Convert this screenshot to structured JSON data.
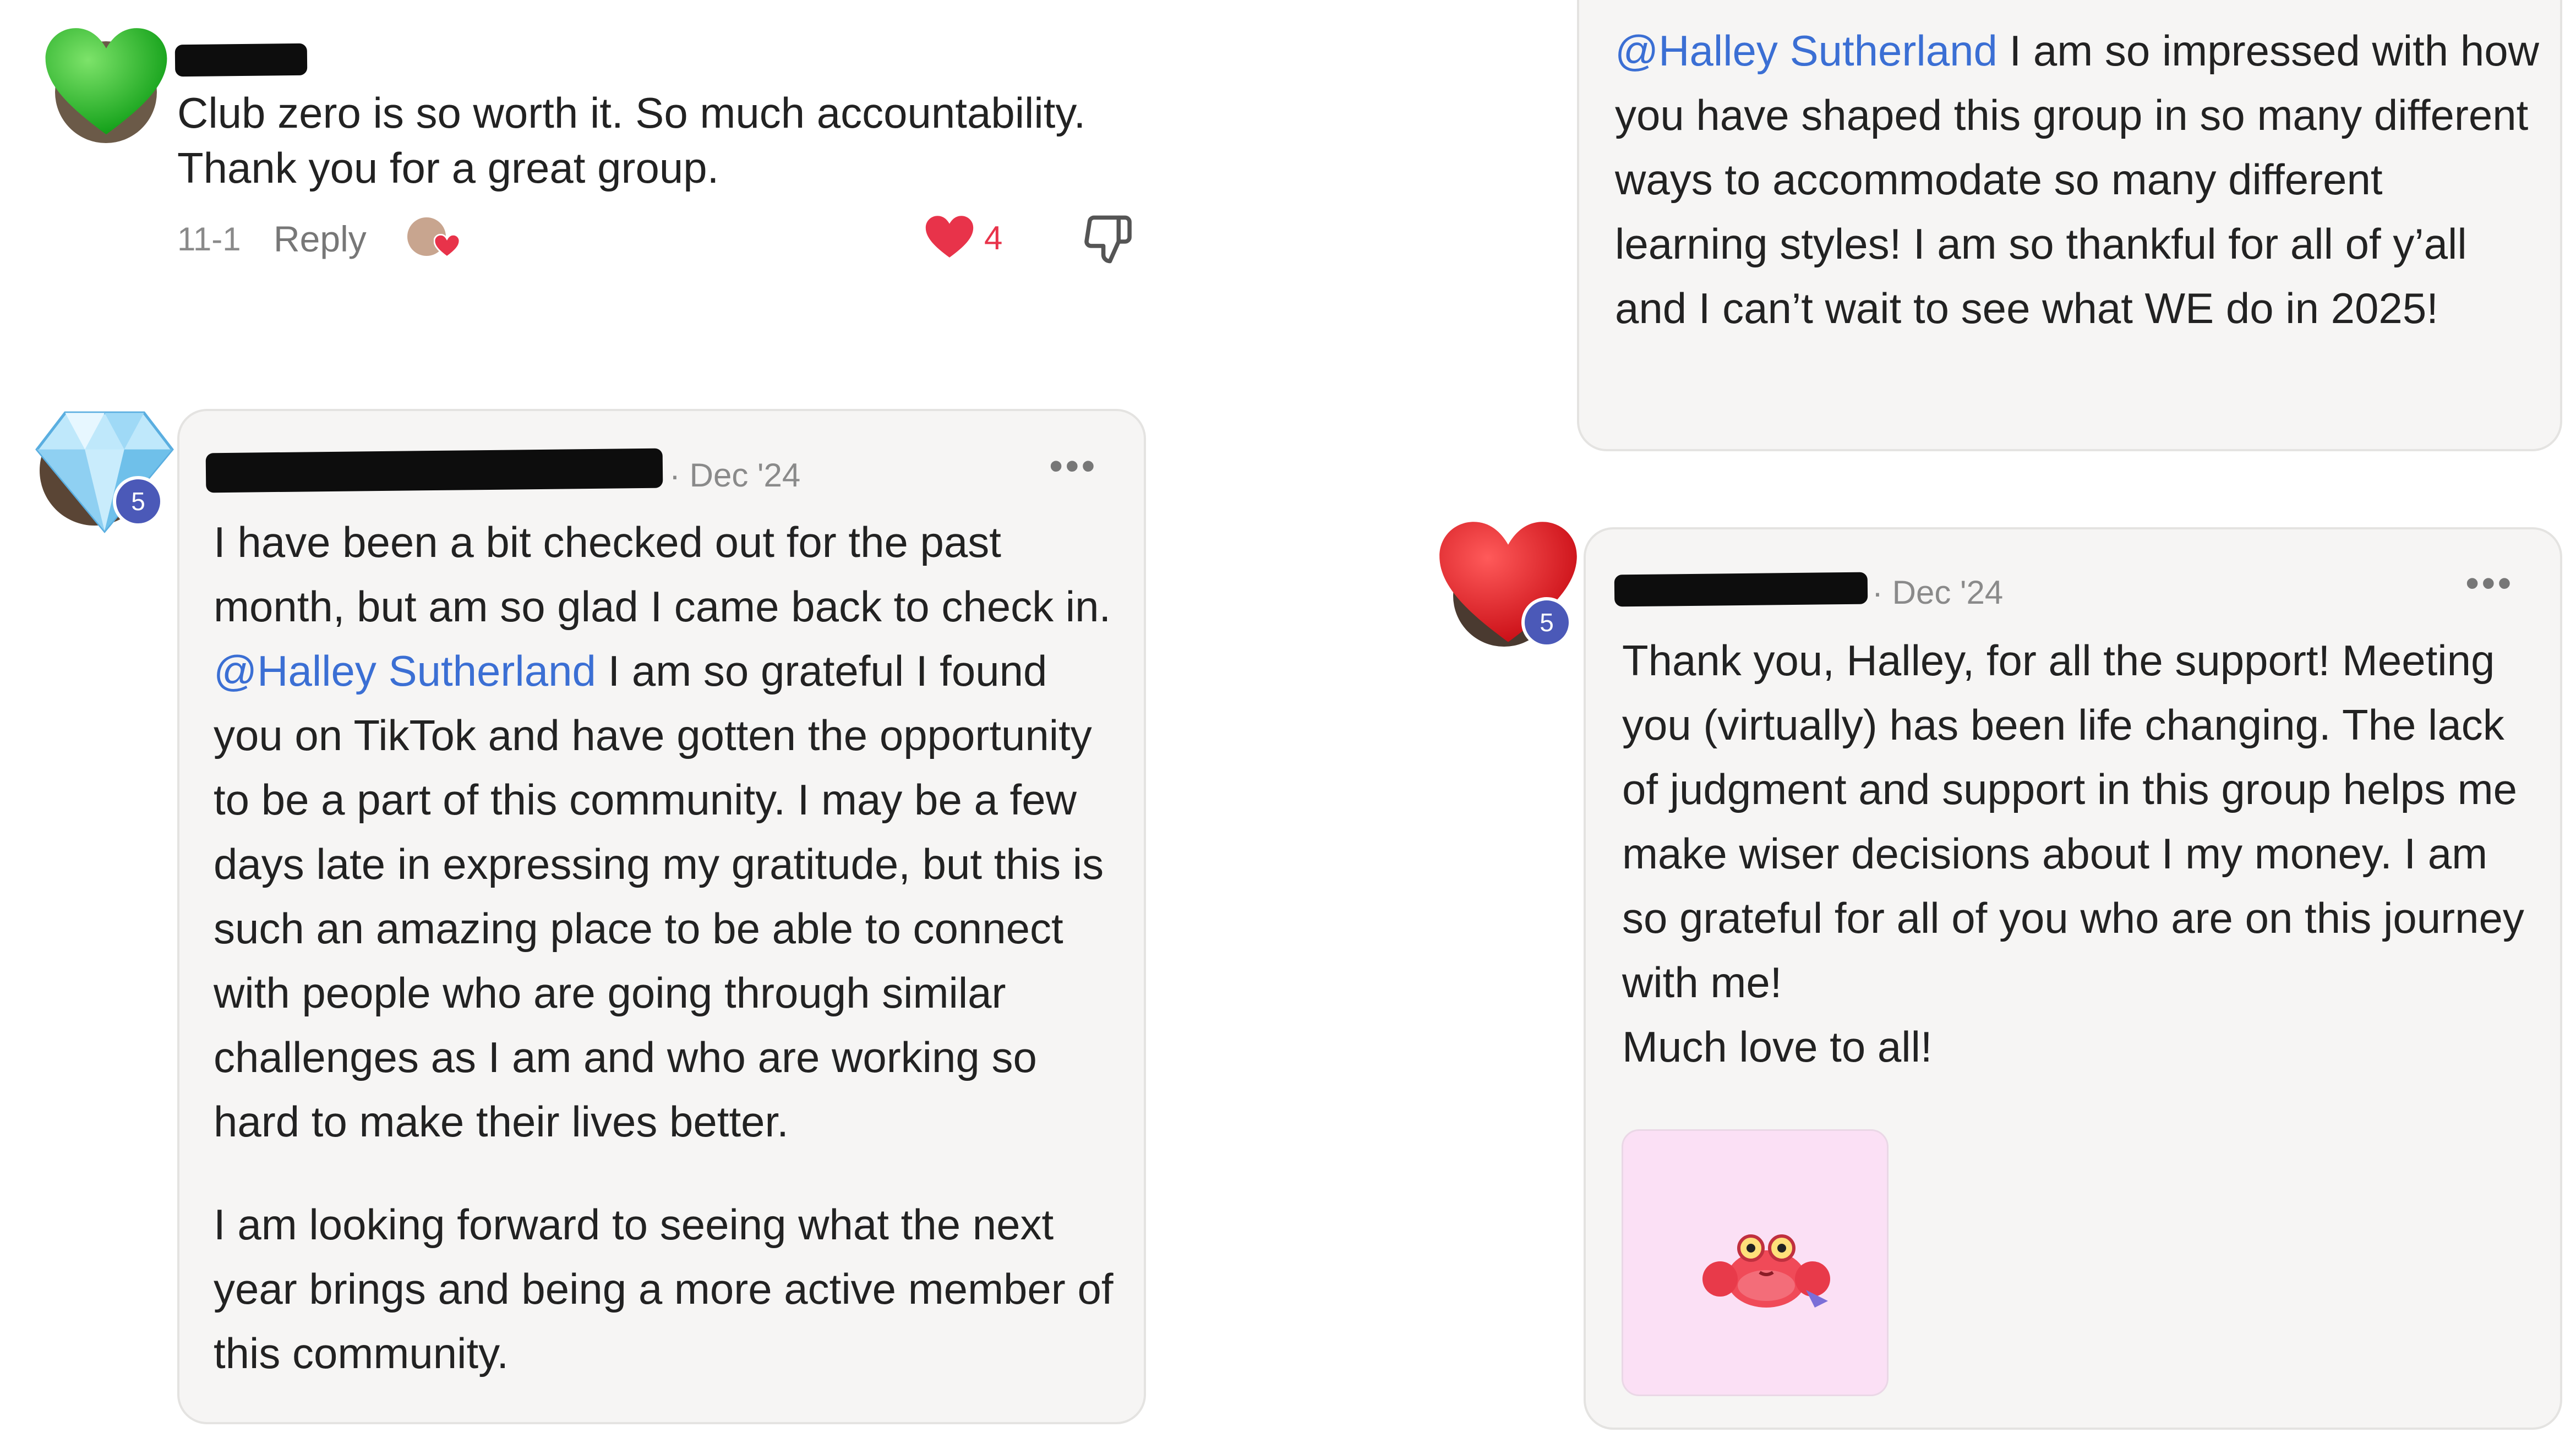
{
  "comment_top": {
    "text": "Club zero is so worth it. So much accountability. Thank you for a great group.",
    "date": "11-1",
    "reply_label": "Reply",
    "like_count": "4"
  },
  "comment_left": {
    "date": "· Dec '24",
    "rank_badge": "5",
    "para1_a": "I have been a bit checked out for the past month, but am so glad I came back to check in.",
    "mention": "@Halley Sutherland",
    "para1_b": " I am so grateful I found you on TikTok and have gotten the opportunity to be a part of this community. I may be a few days late in expressing my gratitude, but this is such an amazing place to be able to connect with people who are going through similar challenges as I am and who are working so hard to make their lives better.",
    "para2": "I am looking forward to seeing what the next year brings and being a more active member of this community."
  },
  "comment_right_top": {
    "mention": "@Halley Sutherland",
    "text": " I am so impressed with how you have shaped this group in so many different ways to accommodate so many different learning styles! I am so thankful for all of y’all and I can’t wait to see what WE do in 2025!"
  },
  "comment_right_bottom": {
    "date": "· Dec '24",
    "rank_badge": "5",
    "text": "Thank you, Halley, for all the support! Meeting you (virtually) has been life changing. The lack of judgment and support in this group helps me make wiser decisions about I my money. I am so grateful for all of you who are on this journey with me!",
    "signoff": "Much love to all!"
  },
  "colors": {
    "mention": "#3b6fd4",
    "heart": "#e8334a",
    "badge": "#4b59b8",
    "sticker_bg": "#fbe0f5"
  },
  "icons": [
    "green-heart-icon",
    "heart-icon",
    "thumbs-down-icon",
    "diamond-icon",
    "red-heart-icon",
    "more-icon",
    "crab-sticker"
  ]
}
